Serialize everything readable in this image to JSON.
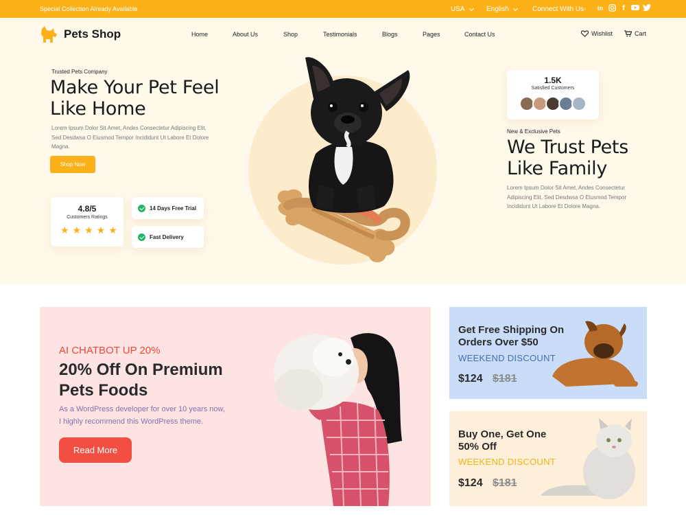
{
  "topbar": {
    "promo": "Special Collection Already Available",
    "country": "USA",
    "language": "English",
    "connect": "Connect With Us-",
    "social_icons": [
      "linkedin-icon",
      "instagram-icon",
      "facebook-icon",
      "youtube-icon",
      "twitter-icon"
    ]
  },
  "header": {
    "brand": "Pets Shop",
    "nav": [
      "Home",
      "About Us",
      "Shop",
      "Testimonials",
      "Blogs",
      "Pages",
      "Contact Us"
    ],
    "wishlist": "Wishlist",
    "cart": "Cart"
  },
  "hero": {
    "kicker": "Trusted Pets Company",
    "title_line1": "Make Your Pet Feel",
    "title_line2": "Like Home",
    "desc_line1": "Lorem Ipsum Dolor Sit Amet, Andes Consectetur Adipiscing Elit,",
    "desc_line2": "Sed Desdwsa O Eiusmod Tempor Incididunt Ut Labore Et Dolore",
    "desc_line3": "Magna.",
    "cta": "Shop Now",
    "rating_value": "4.8/5",
    "rating_label": "Customers Ratings",
    "rating_stars": 5,
    "feature1": "14 Days Free Trial",
    "feature2": "Fast Delivery",
    "satisfied_value": "1.5K",
    "satisfied_label": "Satisfied Customers",
    "right_kicker": "New & Exclusive Pets",
    "right_title_line1": "We Trust Pets",
    "right_title_line2": "Like Family",
    "right_desc_line1": "Lorem Ipsum Dolor Sit Amet, Andes Consectetur",
    "right_desc_line2": "Adipiscing Elit, Sed Desdwsa O Eiusmod Tempor",
    "right_desc_line3": "Incididunt Ut Labore Et Dolore Magna."
  },
  "promo_main": {
    "kicker": "AI CHATBOT UP 20%",
    "title_line1": "20% Off On Premium",
    "title_line2": "Pets Foods",
    "desc_line1": "As a WordPress developer for over 10 years now,",
    "desc_line2": "I highly recommend this WordPress theme.",
    "cta": "Read More"
  },
  "promo_shipping": {
    "title_line1": "Get Free Shipping On",
    "title_line2": "Orders Over $50",
    "subtitle": "WEEKEND DISCOUNT",
    "price": "$124",
    "old_price": "$181"
  },
  "promo_bogo": {
    "title_line1": "Buy One, Get One",
    "title_line2": "50% Off",
    "subtitle": "WEEKEND DISCOUNT",
    "price": "$124",
    "old_price": "$181"
  },
  "colors": {
    "accent": "#fbb117",
    "hero_bg": "#fff9ec",
    "promo_pink": "#fde4e2",
    "promo_blue": "#c9dcf8",
    "promo_cream": "#fdefd9",
    "button_red": "#f34e42",
    "check_green": "#27b26b"
  }
}
